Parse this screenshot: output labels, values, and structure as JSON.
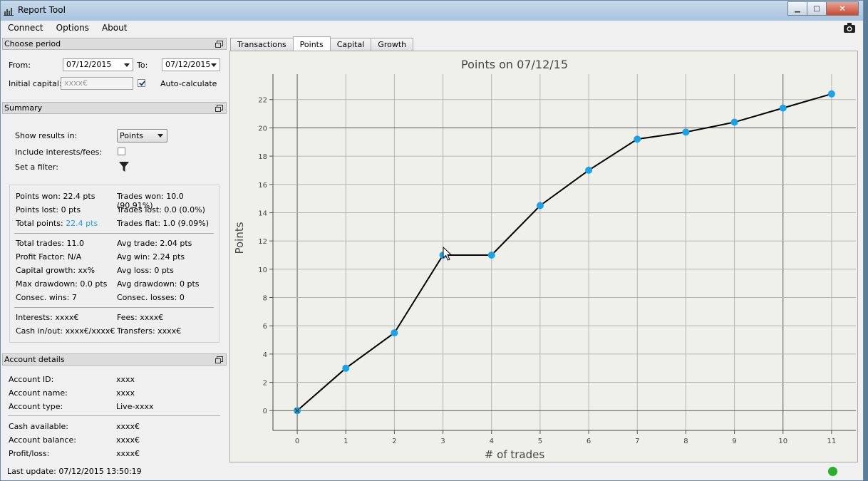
{
  "window": {
    "title": "Report Tool"
  },
  "menu": [
    "Connect",
    "Options",
    "About"
  ],
  "period": {
    "header": "Choose period",
    "from_label": "From:",
    "from_value": "07/12/2015",
    "to_label": "To:",
    "to_value": "07/12/2015",
    "capital_label": "Initial capital:",
    "capital_placeholder": "xxxx€",
    "auto_label": "Auto-calculate",
    "auto_checked": true
  },
  "summary": {
    "header": "Summary",
    "show_label": "Show results in:",
    "show_value": "Points",
    "include_label": "Include interests/fees:",
    "include_checked": false,
    "filter_label": "Set a filter:",
    "stats": {
      "points_won": "Points won: 22.4 pts",
      "trades_won": "Trades won: 10.0 (90.91%)",
      "points_lost": "Points lost: 0 pts",
      "trades_lost": "Trades lost: 0.0 (0.0%)",
      "total_points_label": "Total points: ",
      "total_points_value": "22.4 pts",
      "trades_flat": "Trades flat: 1.0 (9.09%)",
      "total_trades": "Total trades: 11.0",
      "avg_trade": "Avg trade: 2.04 pts",
      "profit_factor": "Profit Factor: N/A",
      "avg_win": "Avg win: 2.24 pts",
      "capital_growth": "Capital growth: xx%",
      "avg_loss": "Avg loss: 0 pts",
      "max_drawdown": "Max drawdown: 0.0 pts",
      "avg_drawdown": "Avg drawdown: 0 pts",
      "consec_wins": "Consec. wins: 7",
      "consec_losses": "Consec. losses: 0",
      "interests": "Interests: xxxx€",
      "fees": "Fees: xxxx€",
      "cash": "Cash in/out: xxxx€/xxxx€",
      "transfers": "Transfers: xxxx€"
    }
  },
  "account": {
    "header": "Account details",
    "rows": [
      {
        "label": "Account ID:",
        "value": "xxxx"
      },
      {
        "label": "Account name:",
        "value": "xxxx"
      },
      {
        "label": "Account type:",
        "value": "Live-xxxx"
      },
      {
        "label": "Cash available:",
        "value": "xxxx€"
      },
      {
        "label": "Account balance:",
        "value": "xxxx€"
      },
      {
        "label": "Profit/loss:",
        "value": "xxxx€"
      }
    ]
  },
  "status": {
    "last_update": "Last update: 07/12/2015 13:50:19",
    "connected_color": "#2ab02a"
  },
  "tabs": [
    "Transactions",
    "Points",
    "Capital",
    "Growth"
  ],
  "active_tab": "Points",
  "colors": {
    "point": "#1aa3e8",
    "line": "#000000",
    "accent": "#1aa3e8"
  },
  "chart_data": {
    "type": "line",
    "title": "Points on 07/12/15",
    "xlabel": "# of trades",
    "ylabel": "Points",
    "x": [
      0,
      1,
      2,
      3,
      4,
      5,
      6,
      7,
      8,
      9,
      10,
      11
    ],
    "series": [
      {
        "values": [
          0,
          3.0,
          5.5,
          11.0,
          11.0,
          14.5,
          17.0,
          19.2,
          19.7,
          20.4,
          21.4,
          22.4
        ]
      }
    ],
    "xlim": [
      -0.5,
      11.5
    ],
    "ylim": [
      -1.4,
      23.8
    ],
    "xticks": [
      0,
      1,
      2,
      3,
      4,
      5,
      6,
      7,
      8,
      9,
      10,
      11
    ],
    "yticks": [
      0,
      2,
      4,
      6,
      8,
      10,
      12,
      14,
      16,
      18,
      20,
      22
    ],
    "grid": true
  }
}
